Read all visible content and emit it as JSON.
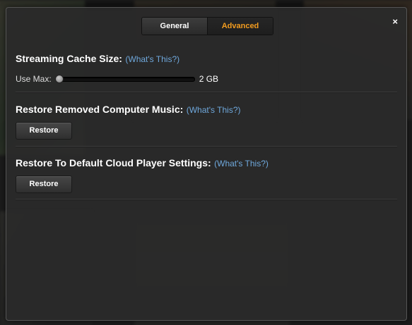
{
  "tabs": [
    {
      "label": "General",
      "active": false
    },
    {
      "label": "Advanced",
      "active": true
    }
  ],
  "close_symbol": "×",
  "cache": {
    "title": "Streaming Cache Size:",
    "help_link": "(What's This?)",
    "slider_label": "Use Max:",
    "slider_value": "2 GB",
    "slider_level_fraction": 0.0
  },
  "restore_music": {
    "title": "Restore Removed Computer Music:",
    "help_link": "(What's This?)",
    "button_label": "Restore"
  },
  "restore_settings": {
    "title": "Restore To Default Cloud Player Settings:",
    "help_link": "(What's This?)",
    "button_label": "Restore"
  },
  "colors": {
    "accent": "#f39c1f",
    "link": "#6fa8dc",
    "dialog_bg": "#2a2a2a"
  },
  "icons": {
    "close": "close-icon",
    "slider_knob": "slider-knob"
  }
}
